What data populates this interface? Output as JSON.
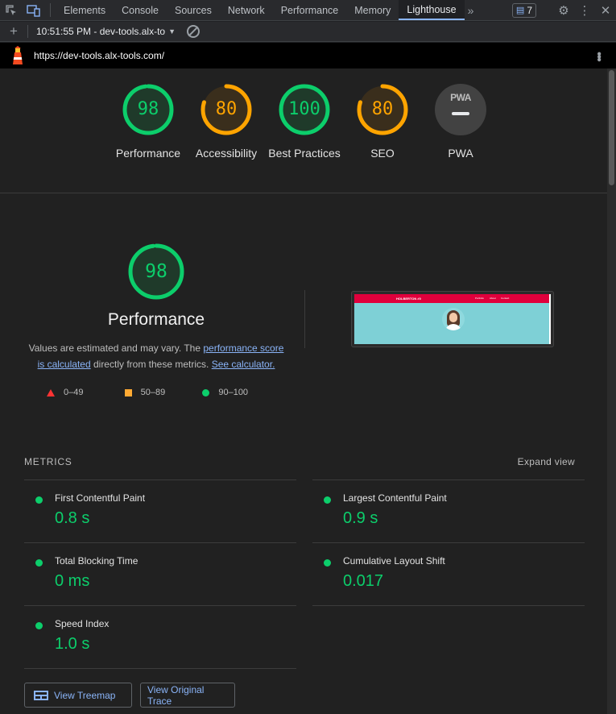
{
  "devtools": {
    "tabs": [
      "Elements",
      "Console",
      "Sources",
      "Network",
      "Performance",
      "Memory",
      "Lighthouse"
    ],
    "active_tab": "Lighthouse",
    "issues_count": "7"
  },
  "lighthouse_toolbar": {
    "report_label": "10:51:55 PM - dev-tools.alx-to"
  },
  "url": "https://dev-tools.alx-tools.com/",
  "colors": {
    "pass": "#0cce6b",
    "average": "#ffa400",
    "fail": "#ff4e42",
    "link": "#8ab4f8"
  },
  "scores": [
    {
      "label": "Performance",
      "score": "98",
      "fraction": 0.98,
      "rating": "pass"
    },
    {
      "label": "Accessibility",
      "score": "80",
      "fraction": 0.8,
      "rating": "average"
    },
    {
      "label": "Best Practices",
      "score": "100",
      "fraction": 1.0,
      "rating": "pass"
    },
    {
      "label": "SEO",
      "score": "80",
      "fraction": 0.8,
      "rating": "average"
    }
  ],
  "pwa": {
    "label": "PWA",
    "badge_text": "PWA"
  },
  "performance": {
    "score": "98",
    "fraction": 0.98,
    "title": "Performance",
    "desc_prefix": "Values are estimated and may vary. The ",
    "desc_link1": "performance score is calculated",
    "desc_middle": " directly from these metrics. ",
    "desc_link2": "See calculator."
  },
  "legend": {
    "fail": "0–49",
    "average": "50–89",
    "pass": "90–100"
  },
  "screenshot": {
    "site_logo": "HOLBERTON #0",
    "nav": [
      "Portfolio",
      "About",
      "Contact"
    ]
  },
  "metrics": {
    "heading": "METRICS",
    "expand": "Expand view",
    "items": [
      {
        "name": "First Contentful Paint",
        "value": "0.8 s"
      },
      {
        "name": "Largest Contentful Paint",
        "value": "0.9 s"
      },
      {
        "name": "Total Blocking Time",
        "value": "0 ms"
      },
      {
        "name": "Cumulative Layout Shift",
        "value": "0.017"
      },
      {
        "name": "Speed Index",
        "value": "1.0 s"
      }
    ]
  },
  "buttons": {
    "treemap": "View Treemap",
    "trace": "View Original Trace"
  }
}
